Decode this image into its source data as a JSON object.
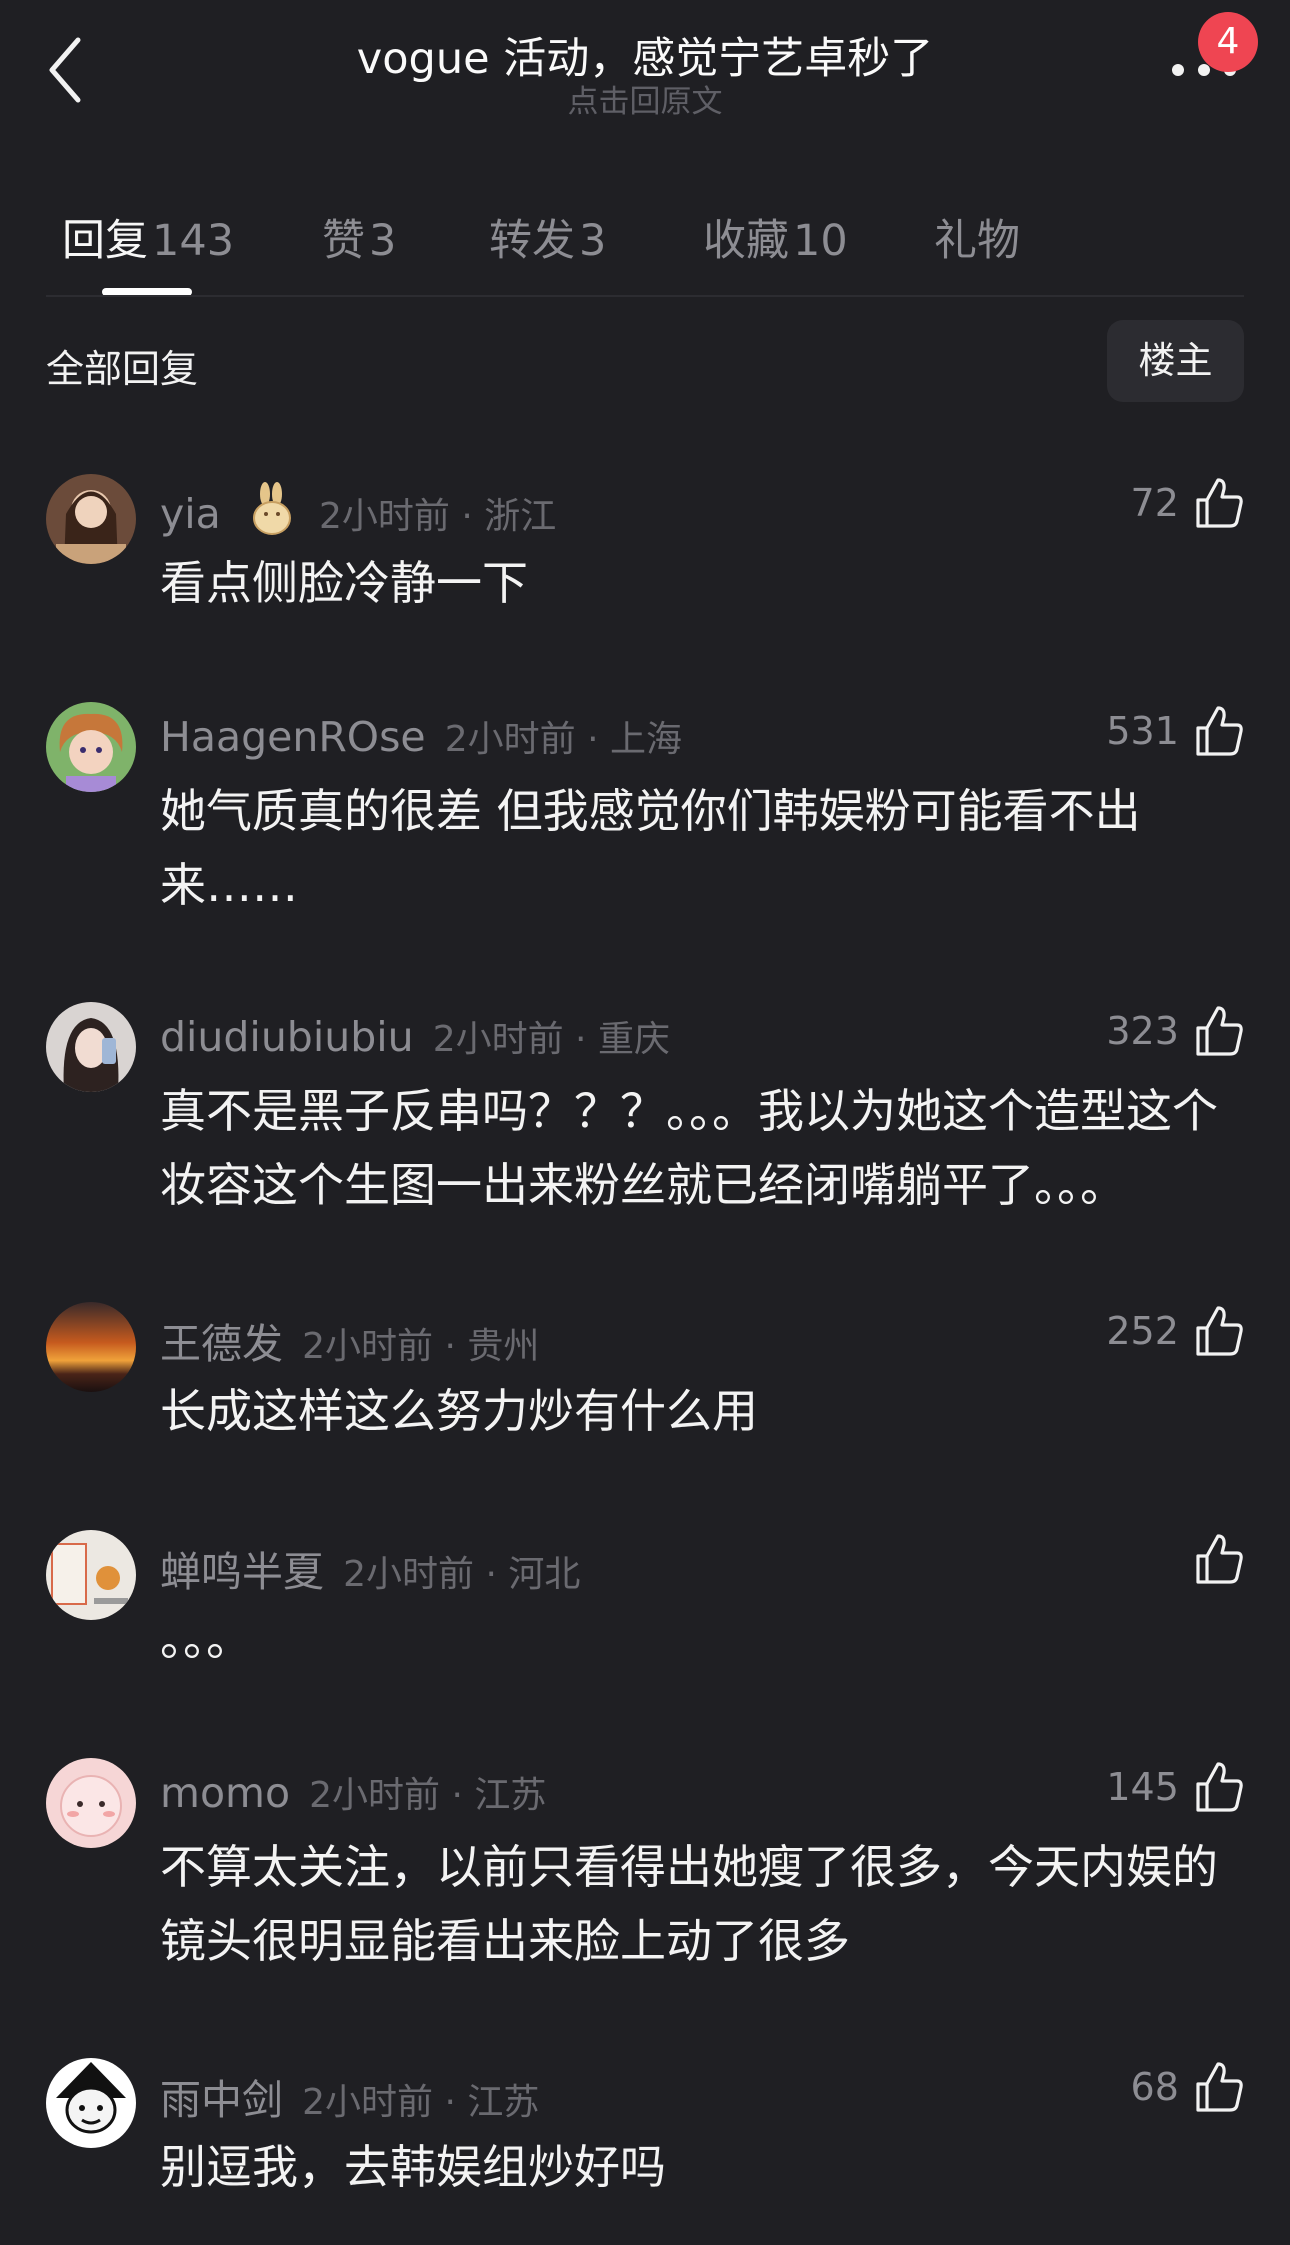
{
  "header": {
    "title": "vogue 活动，感觉宁艺卓秒了",
    "subtitle": "点击回原文",
    "badge": "4",
    "icons": [
      "chevron-left-icon",
      "more-icon"
    ]
  },
  "tabs": [
    {
      "label": "回复",
      "count": "143"
    },
    {
      "label": "赞",
      "count": "3"
    },
    {
      "label": "转发",
      "count": "3"
    },
    {
      "label": "收藏",
      "count": "10"
    },
    {
      "label": "礼物",
      "count": ""
    }
  ],
  "section": {
    "title": "全部回复",
    "owner_button": "楼主"
  },
  "comments": [
    {
      "username": "yia",
      "time_loc": "2小时前 · 浙江",
      "likes": "72",
      "text": "看点侧脸冷静一下"
    },
    {
      "username": "HaagenROse",
      "time_loc": "2小时前 · 上海",
      "likes": "531",
      "text": "她气质真的很差 但我感觉你们韩娱粉可能看不出来……"
    },
    {
      "username": "diudiubiubiu",
      "time_loc": "2小时前 · 重庆",
      "likes": "323",
      "text": "真不是黑子反串吗？？？。。。我以为她这个造型这个妆容这个生图一出来粉丝就已经闭嘴躺平了。。。"
    },
    {
      "username": "王德发",
      "time_loc": "2小时前 · 贵州",
      "likes": "252",
      "text": "长成这样这么努力炒有什么用"
    },
    {
      "username": "蝉鸣半夏",
      "time_loc": "2小时前 · 河北",
      "likes": "",
      "text": "。。。"
    },
    {
      "username": "momo",
      "time_loc": "2小时前 · 江苏",
      "likes": "145",
      "text": "不算太关注，以前只看得出她瘦了很多，今天内娱的镜头很明显能看出来脸上动了很多"
    },
    {
      "username": "雨中剑",
      "time_loc": "2小时前 · 江苏",
      "likes": "68",
      "text": "别逗我，去韩娱组炒好吗"
    }
  ]
}
